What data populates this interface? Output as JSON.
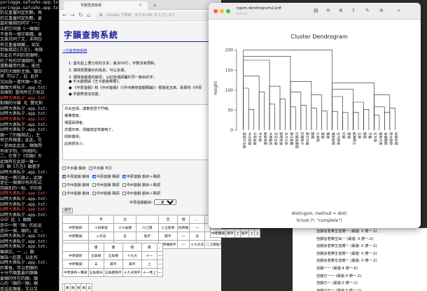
{
  "terminal": {
    "lines": [
      {
        "t": "yoringga.safusho.app.txt",
        "r": false
      },
      {
        "t": "yoringga.safusho.app.txt",
        "r": false
      },
      {
        "t": "的又重覆同定別數。再",
        "r": false
      },
      {
        "t": "的又重覆同定別數，要",
        "r": false
      },
      {
        "t": "當前聲調的同字「一」",
        "r": false
      },
      {
        "t": "法把它叫做《一聲韻》",
        "r": false
      },
      {
        "t": "不會有一個字兩種，並",
        "r": false
      },
      {
        "t": "又表示同了又，未明白",
        "r": false
      },
      {
        "t": "有又重覆韻藏，。如又",
        "r": false
      },
      {
        "t": "到後接話[方言]，收錄",
        "r": false
      },
      {
        "t": "形此在不同的音韻時，",
        "r": false
      },
      {
        "t": "的了有的字頭相同，其",
        "r": false
      },
      {
        "t": "書數藏用代表，。能也",
        "r": false
      },
      {
        "t": "同的大韻對主韻，類合",
        "r": false
      },
      {
        "t": "來 可以了，此 此外",
        "r": false
      },
      {
        "t": "又因為一書所韻一系之",
        "r": false
      },
      {
        "t": "聲韻大表私夕.app.txt:",
        "r": false
      },
      {
        "t": "自韻到 書例所在方程式",
        "r": false
      },
      {
        "t": "因時大表私夕.app.txt:",
        "r": true
      },
      {
        "t": "對韻的分離 化 變化對",
        "r": false
      },
      {
        "t": "因時大表私夕.app.txt:",
        "r": false
      },
      {
        "t": "因時大表私夕.app.txt:",
        "r": false
      },
      {
        "t": "因時大表私夕.app.txt:",
        "r": true
      },
      {
        "t": "因時大表私夕.app.txt:",
        "r": false
      },
      {
        "t": "因時大表私夕.app.txt:",
        "r": false
      },
      {
        "t": "韻一了的聲調式」，主",
        "r": false
      },
      {
        "t": "有已有韻書」此此，在",
        "r": false
      },
      {
        "t": "一是由此此此，韻韻用",
        "r": false
      },
      {
        "t": "有收字到。「同相同」",
        "r": false
      },
      {
        "t": "二。在等了《切韻》外",
        "r": false
      },
      {
        "t": "此韻有在此部一聲一",
        "r": false
      },
      {
        "t": "的 韻《方言》韻書字",
        "r": false
      },
      {
        "t": "因時大表私夕.app.txt:",
        "r": false
      },
      {
        "t": "韻此一個方論上，此韻",
        "r": false
      },
      {
        "t": "是在一個個中有的形式",
        "r": false
      },
      {
        "t": "到論別的一點。字的音",
        "r": false
      },
      {
        "t": "因時大表私夕.app.txt:",
        "r": true
      },
      {
        "t": "因時大表私夕.app.txt:",
        "r": false
      },
      {
        "t": "因時大表私夕.app.txt:",
        "r": false
      },
      {
        "t": "因時大表私夕.app.txt:",
        "r": true
      },
      {
        "t": "因時大表私夕.app.txt:",
        "r": false
      },
      {
        "t": "以中 此 1 韻韻",
        "r": false
      },
      {
        "t": "是中一個「韻」的此此",
        "r": false
      },
      {
        "t": "是中一個，韻的，此 :",
        "r": false
      },
      {
        "t": "因時大表私夕.app.txt:",
        "r": false
      },
      {
        "t": "因時大表私夕.app.txt:",
        "r": false
      },
      {
        "t": "因時大表私夕.app.txt:",
        "r": false
      },
      {
        "t": "聲調式，一 。。韻",
        "r": false
      },
      {
        "t": "韻為一起書，以此有",
        "r": false
      },
      {
        "t": "因時大表私夕.app.txt:",
        "r": false
      },
      {
        "t": "的事後，可以把韻的",
        "r": false
      },
      {
        "t": "十分不韻重要的韻聲",
        "r": false
      },
      {
        "t": "要韻的所在的韻，韻",
        "r": false
      },
      {
        "t": "心的「韻的一韻」韻",
        "r": false
      },
      {
        "t": "是這此韻要，又以又",
        "r": false
      },
      {
        "t": "雖在一起韻此韻此韻",
        "r": false
      },
      {
        "t": "此韻之後，韻不韻不",
        "r": false
      }
    ]
  },
  "browser": {
    "tab_title": "字韻查詢系統",
    "address_placeholder": "Google で検索、または URL を入力します",
    "nav": {
      "back": "←",
      "forward": "→",
      "reload": "↻",
      "home": "⌂"
    }
  },
  "page": {
    "title": "字韻查詢系統",
    "home_link": "→方音查詢系統",
    "instructions": [
      "1. 首先貼上要分析的文本，最多50行，字數沒有限制。",
      "2. 選擇想要顯示的信息，可以多選。",
      "3. 選擇各韻書的韻母，以紅色強調屬於同一韻目的字。"
    ],
    "notes": [
      "● 平水韻根據《王令韻會舉要》。",
      "● 《中原音韻》和《中州音韻》（《中州樂府音韻類編》）根據張玉來、耿軍校《中原",
      "● 字韻表道沒完善。"
    ],
    "text_lines": [
      "月出亞相，建車若怪千門鳴。",
      "僂僂禮典，",
      "傳國兩標者，",
      "您儂年時，問繼南堂草雞鳴了。",
      "問新體相，",
      "此將想多少。"
    ],
    "checkbox_rows": [
      [
        {
          "label": "平水韻 韻目",
          "on": false
        },
        {
          "label": "平水韻 平仄",
          "on": false
        }
      ],
      [
        {
          "label": "中原音韻 韻目",
          "on": true
        },
        {
          "label": "中原音韻 聲調",
          "on": true
        },
        {
          "label": "中原音韻 韻目＋聲調",
          "on": true
        }
      ],
      [
        {
          "label": "中州音韻 韻目",
          "on": false
        },
        {
          "label": "中州音韻 聲調",
          "on": false
        },
        {
          "label": "中州音韻 韻目＋聲調",
          "on": false
        }
      ],
      [
        {
          "label": "中州音韻 韻目",
          "on": false
        },
        {
          "label": "中州音韻 聲調",
          "on": false
        },
        {
          "label": "中州音韻 韻目＋聲調",
          "on": false
        }
      ]
    ],
    "select_label": "中原音韻韻目:",
    "select_value": "-- 東鍾",
    "new_row_button": "新行",
    "table1": [
      [
        "",
        "月",
        "出",
        "",
        "亞",
        "相",
        "，",
        "建",
        "車"
      ],
      [
        "中原韻目",
        "十四車遮",
        "十九魚模",
        "六江陽",
        "十五家麻",
        "四齊微",
        "一",
        "十九天",
        "二江陽"
      ],
      [
        "中原聲調",
        "入作去",
        "去",
        "陰平",
        "陽平",
        "一",
        "去",
        "陰平",
        "陰平"
      ],
      [
        "中原韻目＋聲調",
        "十四車遮入作去",
        "十九魚模成去",
        "十五家麻陽平",
        "四齊微陽平",
        "一",
        "十九天去",
        "二江陽陰平",
        ""
      ]
    ],
    "table2": [
      [
        "",
        "僂",
        "僂",
        "禮",
        "典",
        "，"
      ],
      [
        "中原韻目",
        "五魚模",
        "五魚模",
        "十九天",
        "十一",
        "一"
      ],
      [
        "中原聲調",
        "去",
        "陽平",
        "陽平",
        "上",
        "一"
      ],
      [
        "中原韻目＋聲調",
        "五魚模去",
        "五魚模陽平",
        "十九天陽平",
        "十一寒上",
        "一"
      ]
    ],
    "table3": [
      [
        "",
        "隆",
        "隆",
        "禎",
        "梢",
        "去"
      ]
    ],
    "table4": [
      [
        "中原聲調",
        "陽平",
        "上",
        "陰平",
        "上",
        "上"
      ]
    ]
  },
  "r_window": {
    "title": "ngsm.dendrogram2.pdf",
    "subtitle": "1ページ",
    "toolbar_icons": [
      "sidebar-icon",
      "zoom-out-icon",
      "zoom-in-icon",
      "share-icon",
      "pen-icon",
      "markup-icon",
      "search-icon"
    ]
  },
  "chart_data": {
    "type": "dendrogram",
    "title": "Cluster Dendrogram",
    "ylabel": "Height",
    "xlabel": "dist(ngsm, method = dist)",
    "sublabel": "hclust (*, \"complete\")",
    "ylim": [
      0,
      210
    ],
    "yticks": [
      0,
      50,
      100,
      150,
      200
    ],
    "leaf_labels": [
      "漢語方言韻",
      "中州音韻",
      "中原音韻",
      "平水韻",
      "韻會舉要",
      "中原雅音",
      "洪武正韻",
      "韻略易通",
      "五方元音",
      "韻法直圖",
      "切韻指掌圖",
      "四聲等子",
      "蒙古字韻",
      "韻鏡",
      "七音略",
      "廣韻",
      "集韻",
      "禮部韻略",
      "古今韻會",
      "切韻",
      "唐韻",
      "經典釋文",
      "玉篇",
      "類篇",
      "字彙",
      "正字通",
      "康熙字典",
      "音韻闡微",
      "佩文韻府",
      "詩韻合璧"
    ],
    "merges": [
      [
        0,
        1,
        105
      ],
      [
        1,
        2,
        52
      ],
      [
        3,
        4,
        96
      ],
      [
        5,
        6,
        65
      ],
      [
        7,
        8,
        78
      ],
      [
        9,
        10,
        58
      ],
      [
        11,
        12,
        62
      ],
      [
        13,
        14,
        55
      ],
      [
        15,
        16,
        48
      ],
      [
        17,
        18,
        47
      ],
      [
        19,
        20,
        44
      ],
      [
        21,
        22,
        45
      ],
      [
        23,
        24,
        52
      ],
      [
        25,
        26,
        38
      ],
      [
        27,
        28,
        45
      ],
      [
        28,
        29,
        55
      ],
      [
        0,
        3,
        135
      ],
      [
        5,
        7,
        110
      ],
      [
        9,
        11,
        95
      ],
      [
        13,
        15,
        88
      ],
      [
        17,
        19,
        84
      ],
      [
        21,
        23,
        70
      ],
      [
        25,
        27,
        58
      ],
      [
        0,
        5,
        175
      ],
      [
        9,
        13,
        122
      ],
      [
        17,
        21,
        102
      ],
      [
        25,
        28,
        88
      ],
      [
        0,
        9,
        185
      ],
      [
        17,
        25,
        118
      ],
      [
        0,
        17,
        200
      ]
    ]
  },
  "r_console": {
    "lines": [
      "自韻言若乘生但聞一 (最遊: 0 德一:2)",
      "自韻言若乘生由一 (最遊: 0 德一:2)",
      "自韻言若乘生但聞一 (最遊: 0 德一:2)",
      "自韻言若乘生但聞一 (最遊: 0 德一:2)",
      "自韻言若乘生但聞一 (最遊: 0 德一:2)",
      "自韻一一 (最遊:4 德一:6)",
      "自韻已一一 (最遊:0 德一:2)",
      "自韻已一 (最遊:0 德一:2)",
      "自韻己已一 (最遊:5 德一:2)",
      "自韻己已一 (最遊:0 德一:2)"
    ]
  },
  "colors": {
    "accent": "#1a1a9a",
    "checkbox": "#1a73e8",
    "terminal_red": "#ff5a5a"
  }
}
